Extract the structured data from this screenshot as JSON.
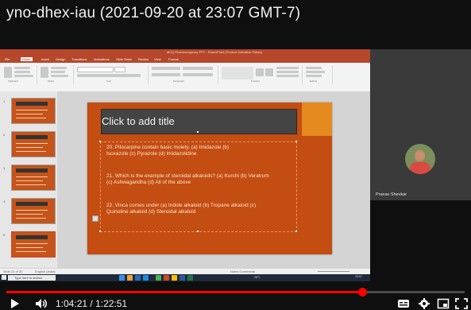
{
  "video": {
    "title": "yno-dhex-iau (2021-09-20 at 23:07 GMT-7)",
    "time_current": "1:04:21",
    "time_separator": " / ",
    "time_total": "1:22:51",
    "progress_fraction": 0.777
  },
  "ppt": {
    "window_title": "MCQ Pharmacognosy PPT - PowerPoint (Product Activation Failed)",
    "tabs": [
      "File",
      "Home",
      "Insert",
      "Design",
      "Transitions",
      "Animations",
      "Slide Show",
      "Review",
      "View",
      "Format"
    ],
    "ribbon_groups": [
      "Clipboard",
      "Slides",
      "Font",
      "Paragraph",
      "Drawing",
      "Editing"
    ],
    "thumbnail_numbers": [
      "1",
      "2",
      "3",
      "4",
      "5"
    ],
    "slide_title_placeholder": "Click to add title",
    "body_lines": [
      "20. Pilocarpine contain                    basic moiety. (a) Imidazole (b)",
      "Isoxazole (c) Pyrazole (d) Imidazolidine",
      "21. Which is the example of steroidal alkaloids? (a) Kurchi (b) Veratrum",
      "(c) Ashwagandha (d) All of the above",
      "22. Vinca comes under (a) Indole alkaloid (b) Tropane alkaloid (c)",
      "Quinoline alkaloid (d) Steroidal alkaloid"
    ],
    "status_left": "Slide 24 of 30",
    "status_lang": "English (India)",
    "status_right": "Notes  Comments",
    "taskbar_search": "Type here to search",
    "taskbar_time": "23:07",
    "taskbar_temp": "26°C"
  },
  "participant": {
    "name": "Pranav Shevkar"
  },
  "colors": {
    "slide_bg": "#c44d12",
    "progress": "#ff0000"
  },
  "icons": [
    "play-icon",
    "volume-icon",
    "subtitles-icon",
    "settings-icon",
    "miniplayer-icon",
    "fullscreen-icon"
  ]
}
